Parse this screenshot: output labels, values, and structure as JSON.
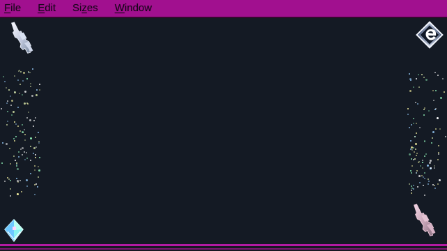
{
  "menu": {
    "items": [
      {
        "id": "file",
        "mnemonic": "F",
        "rest": "ile"
      },
      {
        "id": "edit",
        "mnemonic": "E",
        "rest": "dit"
      },
      {
        "id": "sizes",
        "mnemonic": "",
        "pre": "Si",
        "underlined": "z",
        "post": "es"
      },
      {
        "id": "window",
        "mnemonic": "W",
        "rest": "indow"
      }
    ]
  },
  "theme": {
    "menubar": "#a1108f",
    "background": "#151b26",
    "accent": "#b21aa2",
    "particles": [
      "#d8e6a8",
      "#9ad0ff",
      "#f4f0a0",
      "#8ff0b8",
      "#ffffff"
    ]
  },
  "icons": [
    {
      "name": "assault-rifle-icon",
      "position_label": "top-left"
    },
    {
      "name": "e-diamond-logo-icon",
      "position_label": "top-right"
    },
    {
      "name": "assault-rifle-icon",
      "position_label": "bottom-right"
    },
    {
      "name": "crystal-cube-icon",
      "position_label": "bottom-left"
    }
  ]
}
